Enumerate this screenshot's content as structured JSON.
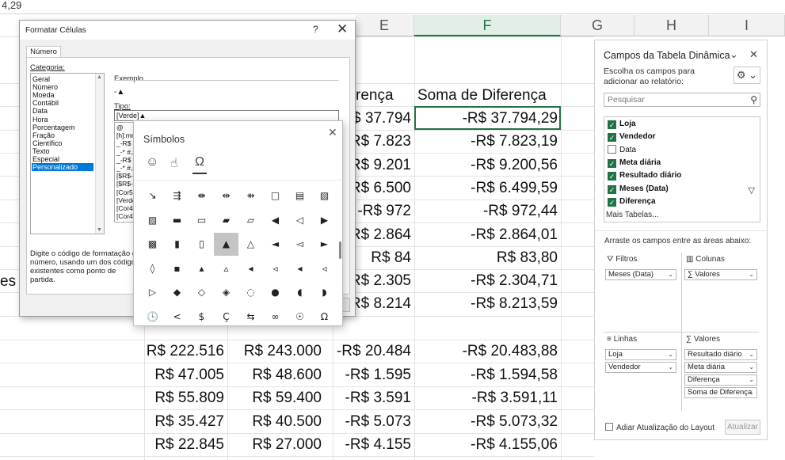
{
  "formula_bar": {
    "text": "4,29"
  },
  "columns": [
    {
      "label": "E",
      "x": 0
    },
    {
      "label": "F",
      "selected": true
    },
    {
      "label": "G"
    },
    {
      "label": "H"
    },
    {
      "label": "I"
    }
  ],
  "sheet": {
    "header_e": "rença",
    "header_f": "Soma de Diferença",
    "row_label_fragment": "es",
    "upper_rows": [
      {
        "e": "-R$ 37.794",
        "f": "-R$ 37.794,29"
      },
      {
        "e": "-R$ 7.823",
        "f": "-R$ 7.823,19"
      },
      {
        "e": "-R$ 9.201",
        "f": "-R$ 9.200,56"
      },
      {
        "e": "-R$ 6.500",
        "f": "-R$ 6.499,59"
      },
      {
        "e": "-R$ 972",
        "f": "-R$ 972,44"
      },
      {
        "e": "-R$ 2.864",
        "f": "-R$ 2.864,01"
      },
      {
        "e": "R$ 84",
        "f": "R$ 83,80"
      },
      {
        "e": "-R$ 2.305",
        "f": "-R$ 2.304,71"
      },
      {
        "e": "-R$ 8.214",
        "f": "-R$ 8.213,59"
      }
    ],
    "lower_rows": [
      {
        "c": "R$ 222.516",
        "d": "R$ 243.000",
        "e": "-R$ 20.484",
        "f": "-R$ 20.483,88"
      },
      {
        "c": "R$ 47.005",
        "d": "R$ 48.600",
        "e": "-R$ 1.595",
        "f": "-R$ 1.594,58"
      },
      {
        "c": "R$ 55.809",
        "d": "R$ 59.400",
        "e": "-R$ 3.591",
        "f": "-R$ 3.591,11"
      },
      {
        "c": "R$ 35.427",
        "d": "R$ 40.500",
        "e": "-R$ 5.073",
        "f": "-R$ 5.073,32"
      },
      {
        "c": "R$ 22.845",
        "d": "R$ 27.000",
        "e": "-R$ 4.155",
        "f": "-R$ 4.155,06"
      }
    ]
  },
  "dialog": {
    "title": "Formatar Células",
    "help": "?",
    "close": "✕",
    "tab": "Número",
    "category_label": "Categoria:",
    "categories": [
      "Geral",
      "Número",
      "Moeda",
      "Contábil",
      "Data",
      "Hora",
      "Porcentagem",
      "Fração",
      "Científico",
      "Texto",
      "Especial",
      "Personalizado"
    ],
    "selected_category": "Personalizado",
    "example_label": "Exemplo",
    "example_value": "-▲",
    "type_label": "Tipo:",
    "type_value": "[Verde]▲",
    "format_list": [
      "@",
      "[h]:mm:",
      "_-R$ * #",
      "_-* #,##",
      "_-R$ * #",
      "_-* #,##",
      "[$R$-pt",
      "[$R$-pt",
      "[Cor50]",
      "[Verde]",
      "[Cor43]",
      "[Cor43]"
    ],
    "note": "Digite o código de formatação do número, usando um dos códigos existentes como ponto de partida."
  },
  "symbols": {
    "title": "Símbolos",
    "close": "✕",
    "tabs": [
      {
        "glyph": "☺",
        "icon": "smiley-icon"
      },
      {
        "glyph": "☝",
        "icon": "cursor-hand-icon"
      },
      {
        "glyph": "Ω",
        "icon": "omega-icon",
        "active": true
      }
    ],
    "grid": [
      [
        "↘",
        "⇶",
        "⇼",
        "⇹",
        "⇻",
        "□",
        "▤",
        "▧"
      ],
      [
        "▨",
        "▬",
        "▭",
        "▰",
        "▱",
        "◀",
        "◁",
        "▶"
      ],
      [
        "▩",
        "▮",
        "▯",
        "▲",
        "△",
        "◄",
        "◅",
        "►"
      ],
      [
        "◊",
        "▪",
        "▴",
        "▵",
        "◂",
        "◃",
        "◂",
        "◃"
      ],
      [
        "▷",
        "◆",
        "◇",
        "◈",
        "◌",
        "●",
        "◖",
        "◗"
      ],
      [
        "🕓",
        "<",
        "$",
        "Ç",
        "⇆",
        "∞",
        "☉",
        "Ω"
      ]
    ],
    "highlighted": [
      2,
      3
    ]
  },
  "pivot": {
    "title": "Campos da Tabela Dinâmica",
    "desc": "Escolha os campos para adicionar ao relatório:",
    "search_placeholder": "Pesquisar",
    "fields": [
      {
        "label": "Loja",
        "checked": true
      },
      {
        "label": "Vendedor",
        "checked": true
      },
      {
        "label": "Data",
        "checked": false
      },
      {
        "label": "Meta diária",
        "checked": true
      },
      {
        "label": "Resultado diário",
        "checked": true
      },
      {
        "label": "Meses (Data)",
        "checked": true
      },
      {
        "label": "Diferença",
        "checked": true
      }
    ],
    "more_tables": "Mais Tabelas...",
    "drag_label": "Arraste os campos entre as áreas abaixo:",
    "areas": {
      "filtros": {
        "title": "Filtros",
        "items": [
          "Meses (Data)"
        ]
      },
      "colunas": {
        "title": "Colunas",
        "items": [
          "∑ Valores"
        ]
      },
      "linhas": {
        "title": "Linhas",
        "items": [
          "Loja",
          "Vendedor"
        ]
      },
      "valores": {
        "title": "Valores",
        "items": [
          "Resultado diário",
          "Meta diária",
          "Diferença",
          "Soma de Diferença"
        ]
      }
    },
    "defer_label": "Adiar Atualização do Layout",
    "update_button": "Atualizar"
  }
}
